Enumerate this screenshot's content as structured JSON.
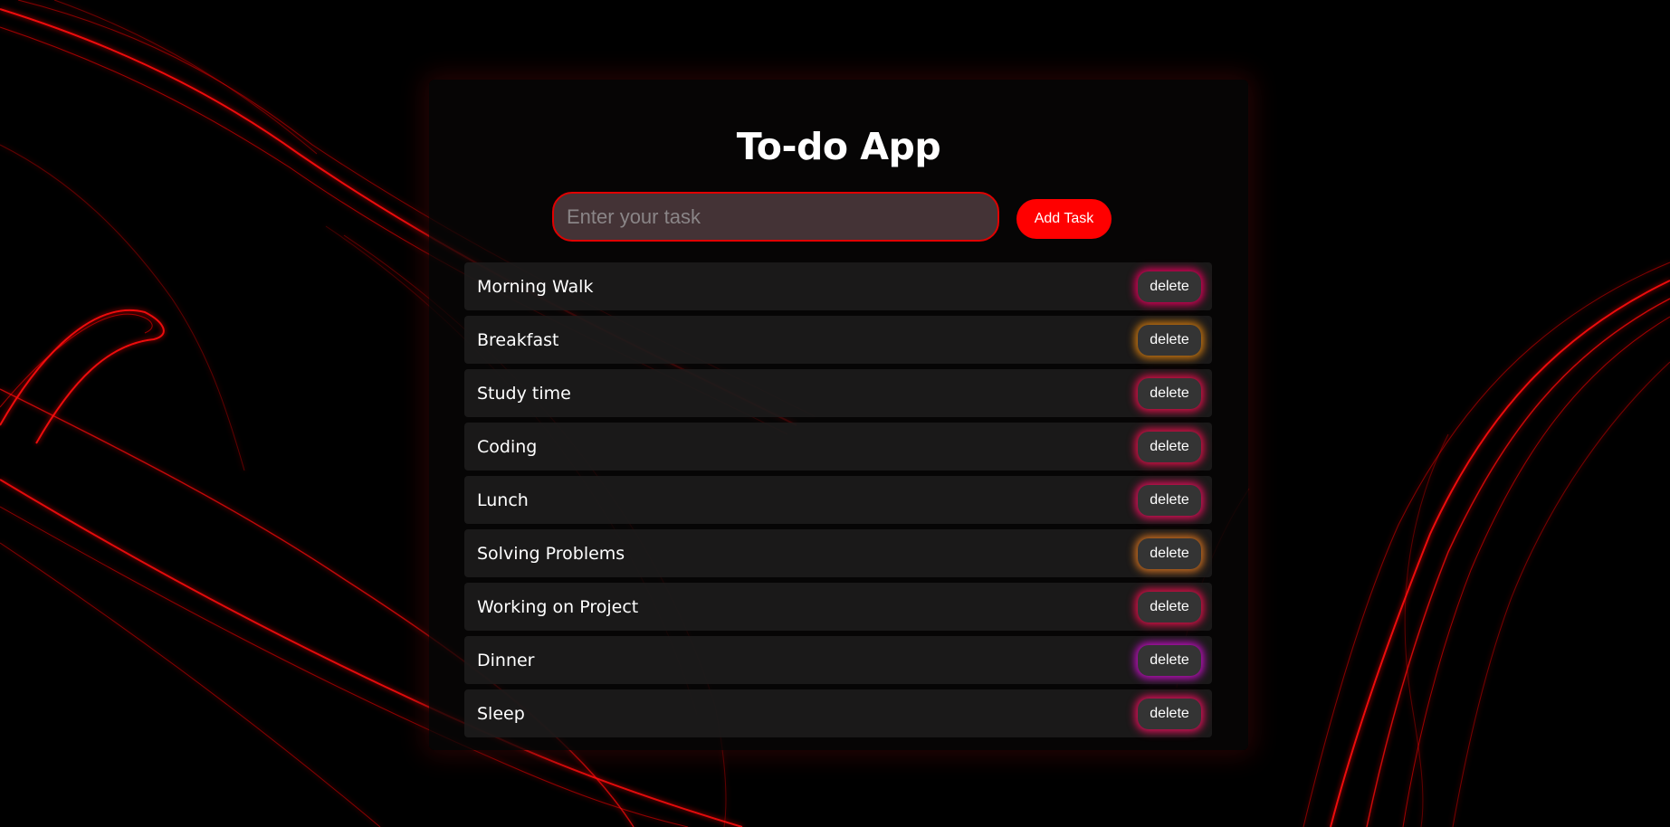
{
  "app": {
    "title": "To-do App"
  },
  "input": {
    "placeholder": "Enter your task",
    "value": ""
  },
  "add_button": {
    "label": "Add Task"
  },
  "tasks": [
    {
      "label": "Morning Walk",
      "delete_label": "delete",
      "glow": "#e0005a"
    },
    {
      "label": "Breakfast",
      "delete_label": "delete",
      "glow": "#d07a10"
    },
    {
      "label": "Study time",
      "delete_label": "delete",
      "glow": "#e0104a"
    },
    {
      "label": "Coding",
      "delete_label": "delete",
      "glow": "#e0104a"
    },
    {
      "label": "Lunch",
      "delete_label": "delete",
      "glow": "#e0105a"
    },
    {
      "label": "Solving Problems",
      "delete_label": "delete",
      "glow": "#d07020"
    },
    {
      "label": "Working on Project",
      "delete_label": "delete",
      "glow": "#e0104a"
    },
    {
      "label": "Dinner",
      "delete_label": "delete",
      "glow": "#c010c0"
    },
    {
      "label": "Sleep",
      "delete_label": "delete",
      "glow": "#e0105a"
    }
  ],
  "colors": {
    "background": "#000000",
    "accent": "#ff0000",
    "row_background": "#1e1c1d",
    "delete_background": "#343434"
  }
}
